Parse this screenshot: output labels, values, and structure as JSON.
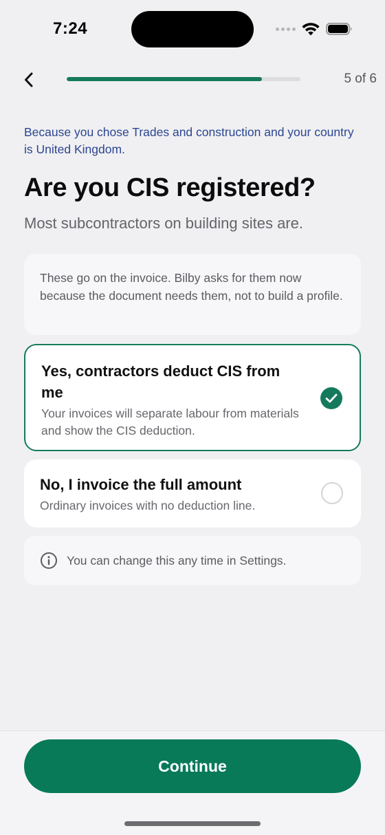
{
  "status_bar": {
    "time": "7:24"
  },
  "nav": {
    "back_icon": "chevron-left-icon",
    "progress_fraction": 0.835,
    "step_label": "5 of 6"
  },
  "context_text": "Because you chose Trades and construction and your country is United Kingdom.",
  "title": "Are you CIS registered?",
  "subtitle": "Most subcontractors on building sites are.",
  "note": "These go on the invoice. Bilby asks for them now because the document needs them, not to build a profile.",
  "options": [
    {
      "title": "Yes, contractors deduct CIS from me",
      "description": "Your invoices will separate labour from materials and show the CIS deduction.",
      "selected": true
    },
    {
      "title": "No, I invoice the full amount",
      "description": "Ordinary invoices with no deduction line.",
      "selected": false
    }
  ],
  "info": {
    "icon": "info-icon",
    "text": "You can change this any time in Settings."
  },
  "continue_label": "Continue",
  "colors": {
    "accent": "#157a5b",
    "button": "#087a58",
    "context_text": "#2b4591"
  }
}
